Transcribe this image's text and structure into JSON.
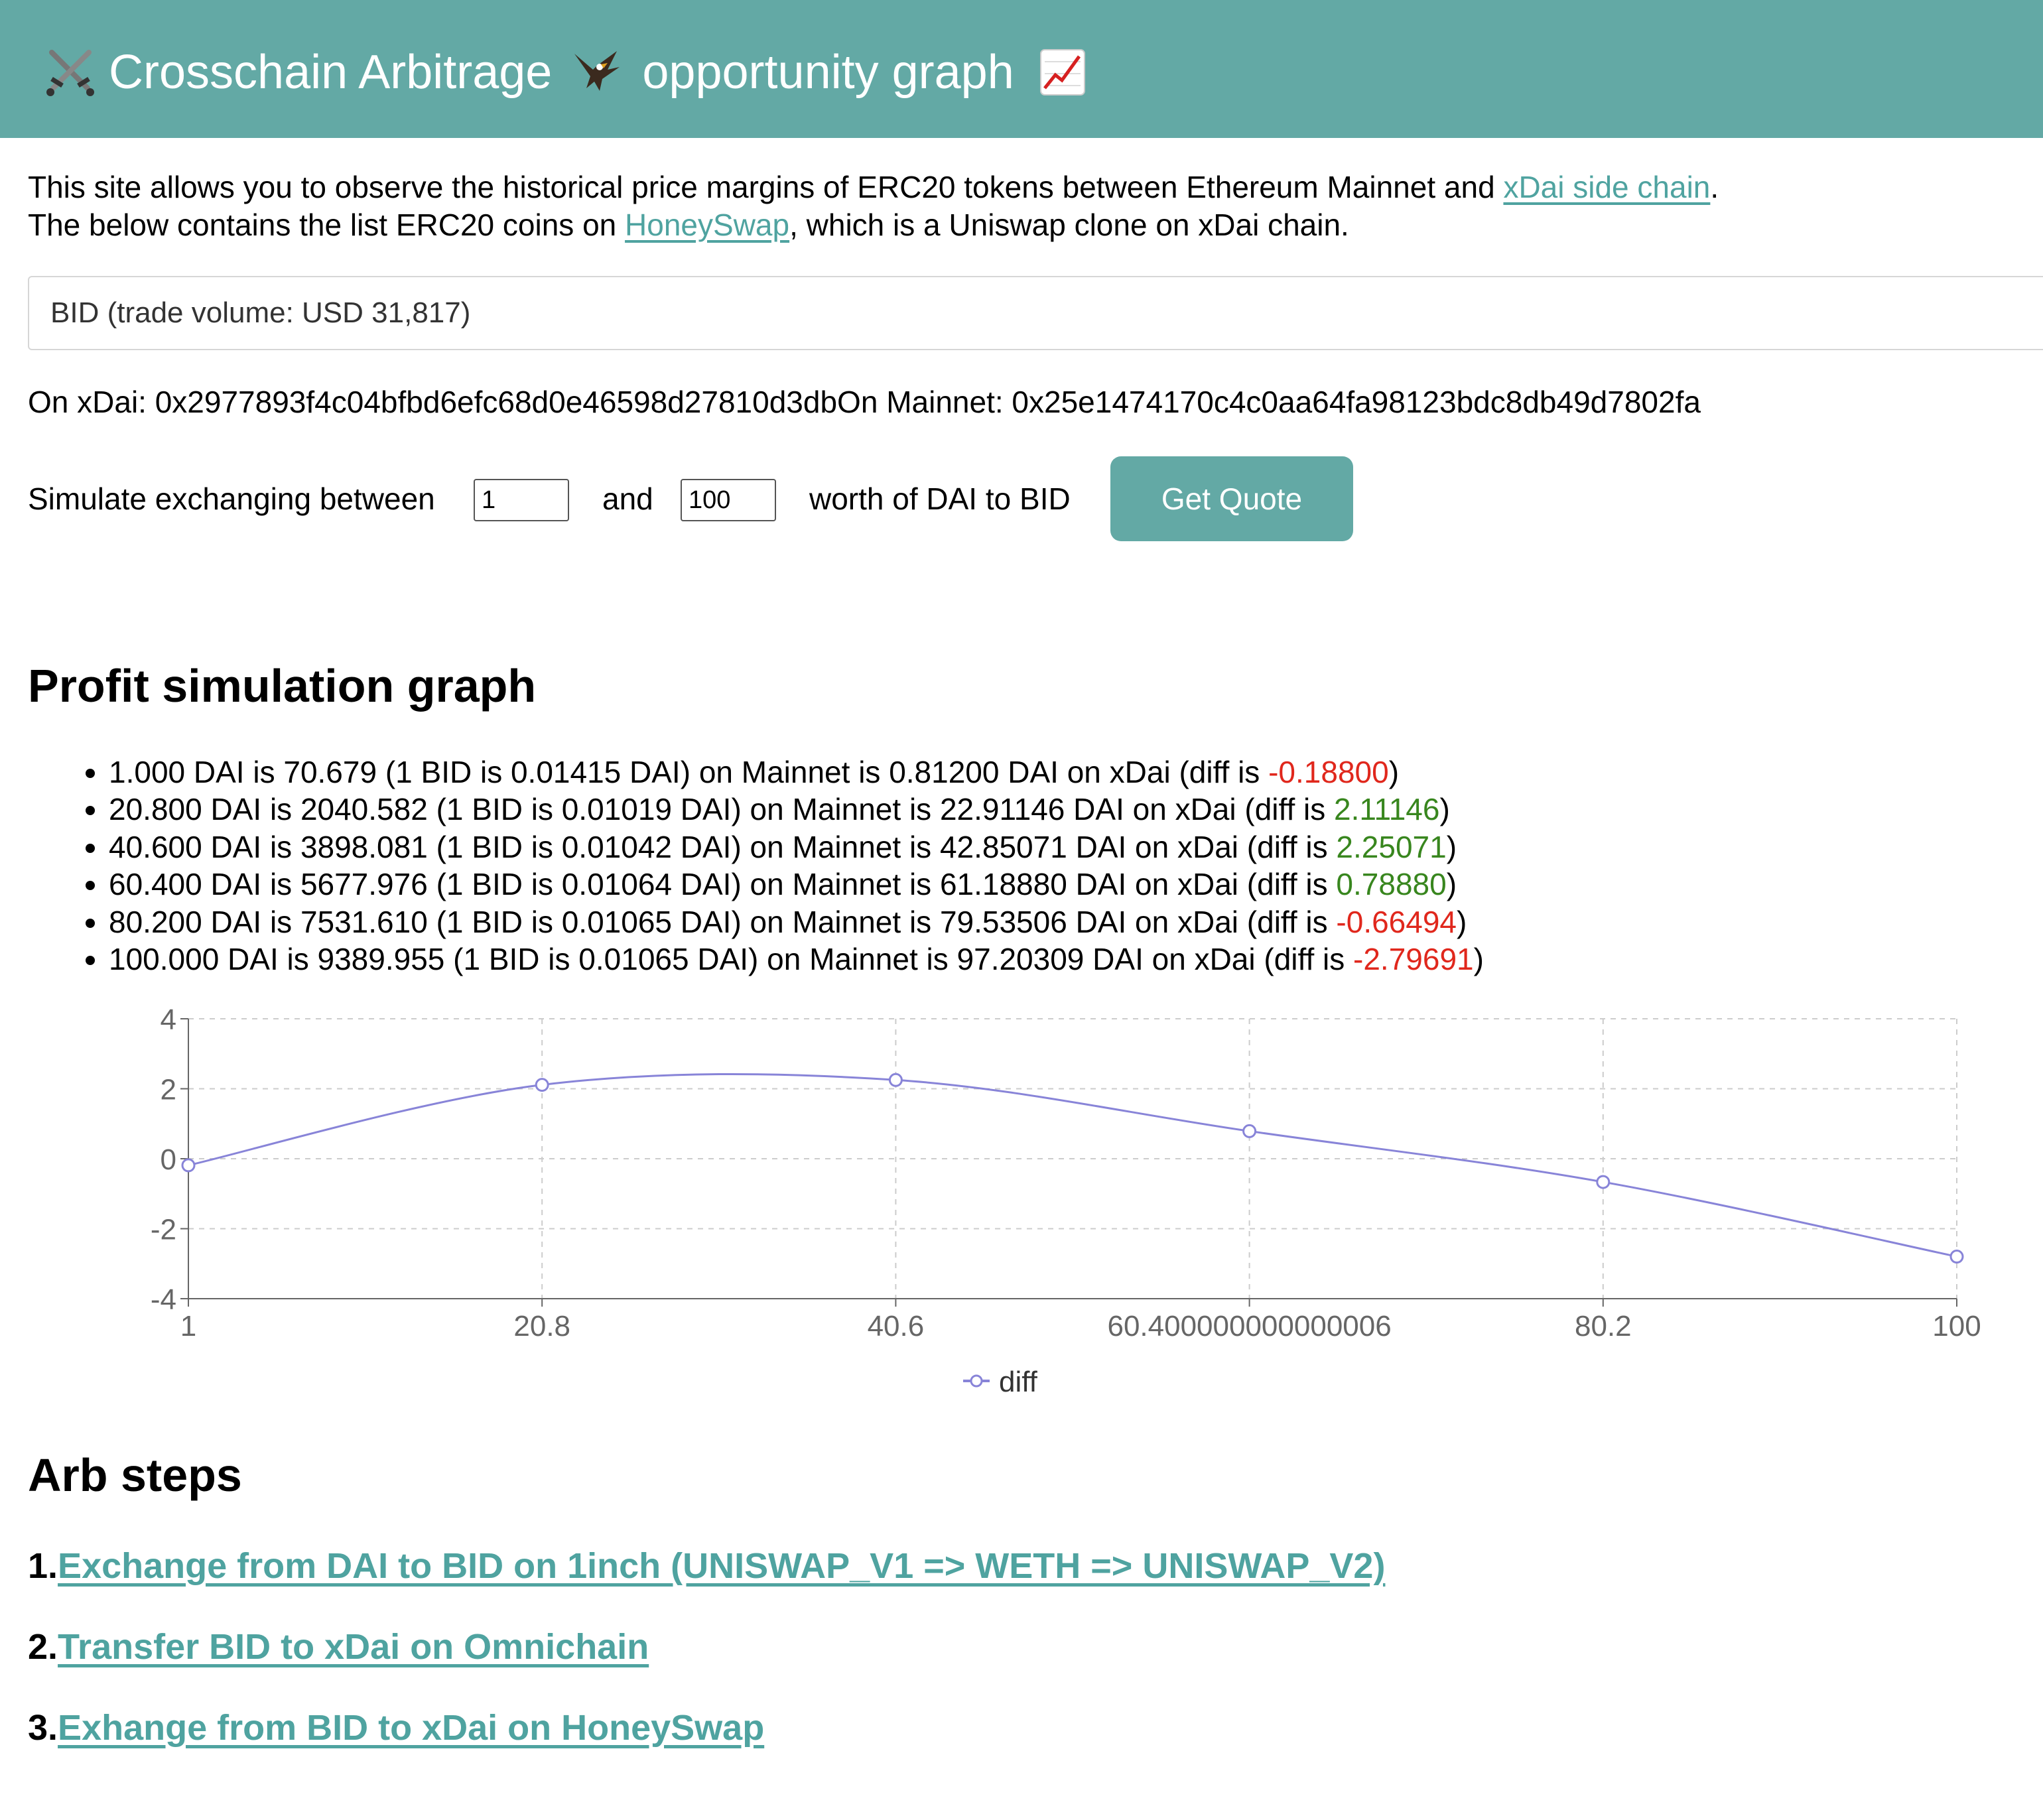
{
  "header": {
    "title_part1": "Crosschain Arbitrage",
    "title_part2": "opportunity graph",
    "icons": [
      "crossed-swords-icon",
      "eagle-icon",
      "chart-increasing-icon"
    ],
    "background": "#63a9a5"
  },
  "intro": {
    "line1_prefix": "This site allows you to observe the historical price margins of ERC20 tokens between Ethereum Mainnet and ",
    "line1_link": "xDai side chain",
    "line1_suffix": ".",
    "line2_prefix": "The below contains the list ERC20 coins on ",
    "line2_link": "HoneySwap",
    "line2_suffix": ", which is a Uniswap clone on xDai chain."
  },
  "token_select": {
    "selected": "BID (trade volume: USD 31,817)"
  },
  "addresses": {
    "text": "On xDai: 0x2977893f4c04bfbd6efc68d0e46598d27810d3dbOn Mainnet: 0x25e1474170c4c0aa64fa98123bdc8db49d7802fa"
  },
  "simulate": {
    "label_start": "Simulate exchanging between",
    "min_value": "1",
    "label_and": "and",
    "max_value": "100",
    "label_end": "worth of DAI to BID",
    "button": "Get Quote"
  },
  "profit_section": {
    "heading": "Profit simulation graph",
    "results": [
      {
        "text": "1.000 DAI is 70.679 (1 BID is 0.01415 DAI) on Mainnet is 0.81200 DAI on xDai (diff is ",
        "diff": "-0.18800",
        "tail": ")"
      },
      {
        "text": "20.800 DAI is 2040.582 (1 BID is 0.01019 DAI) on Mainnet is 22.91146 DAI on xDai (diff is ",
        "diff": "2.11146",
        "tail": ")"
      },
      {
        "text": "40.600 DAI is 3898.081 (1 BID is 0.01042 DAI) on Mainnet is 42.85071 DAI on xDai (diff is ",
        "diff": "2.25071",
        "tail": ")"
      },
      {
        "text": "60.400 DAI is 5677.976 (1 BID is 0.01064 DAI) on Mainnet is 61.18880 DAI on xDai (diff is ",
        "diff": "0.78880",
        "tail": ")"
      },
      {
        "text": "80.200 DAI is 7531.610 (1 BID is 0.01065 DAI) on Mainnet is 79.53506 DAI on xDai (diff is ",
        "diff": "-0.66494",
        "tail": ")"
      },
      {
        "text": "100.000 DAI is 9389.955 (1 BID is 0.01065 DAI) on Mainnet is 97.20309 DAI on xDai (diff is ",
        "diff": "-2.79691",
        "tail": ")"
      }
    ],
    "colors": {
      "negative": "#e0271c",
      "positive": "#38861e"
    }
  },
  "chart_data": {
    "type": "line",
    "x": [
      "1",
      "20.8",
      "40.6",
      "60.400000000000006",
      "80.2",
      "100"
    ],
    "series": [
      {
        "name": "diff",
        "values": [
          -0.188,
          2.11146,
          2.25071,
          0.7888,
          -0.66494,
          -2.79691
        ],
        "color": "#8884d8"
      }
    ],
    "yticks": [
      "-4",
      "-2",
      "0",
      "2",
      "4"
    ],
    "ylim": [
      -4,
      4
    ],
    "grid": true,
    "legend": "bottom"
  },
  "arb_section": {
    "heading": "Arb steps",
    "steps": [
      {
        "num": "1.",
        "label": "Exchange from DAI to BID on 1inch (UNISWAP_V1 => WETH => UNISWAP_V2)"
      },
      {
        "num": "2.",
        "label": "Transfer BID to xDai on Omnichain"
      },
      {
        "num": "3.",
        "label": "Exhange from BID to xDai on HoneySwap"
      }
    ]
  }
}
